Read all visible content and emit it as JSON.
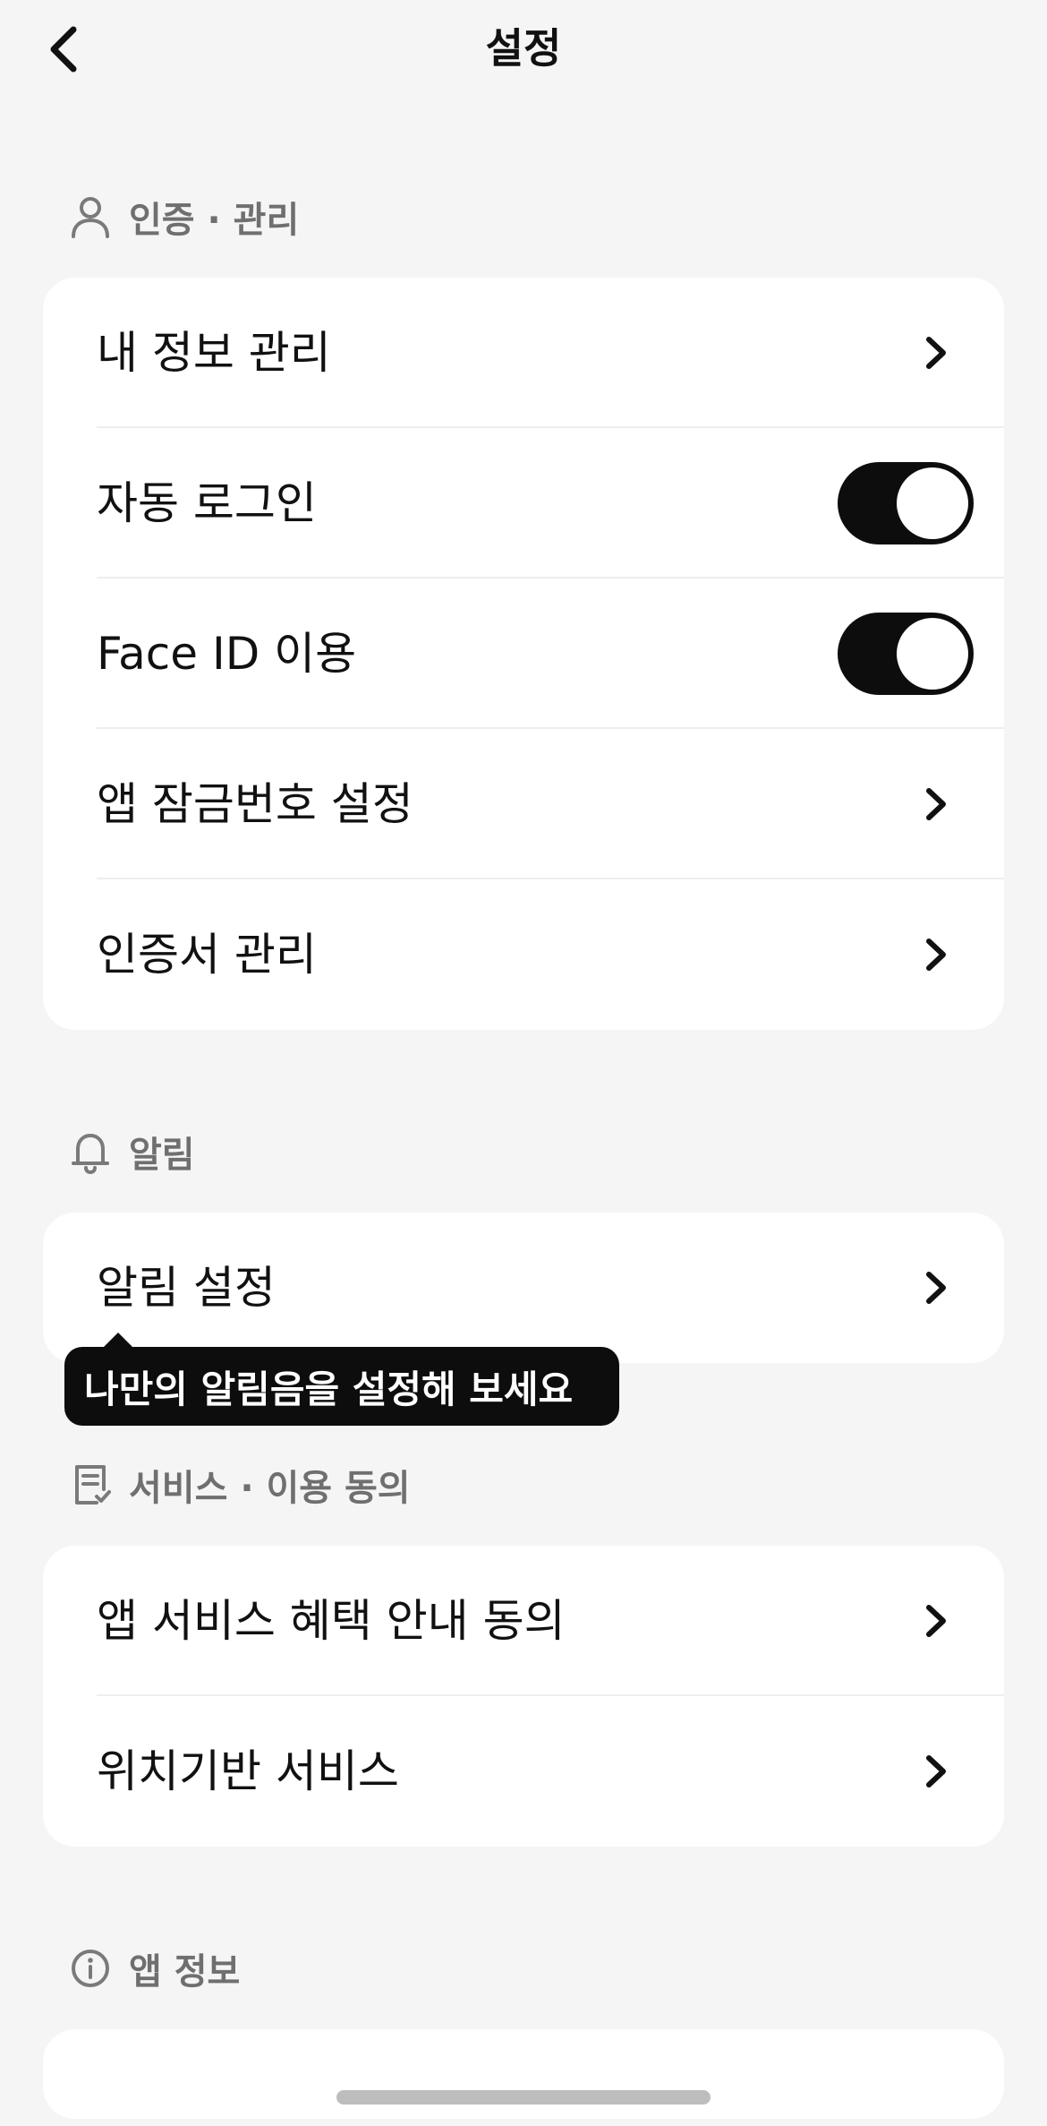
{
  "header": {
    "title": "설정"
  },
  "sections": {
    "auth": {
      "title": "인증 · 관리",
      "rows": [
        {
          "label": "내 정보 관리"
        },
        {
          "label": "자동 로그인",
          "toggle_on": true
        },
        {
          "label": "Face ID 이용",
          "toggle_on": true
        },
        {
          "label": "앱 잠금번호 설정"
        },
        {
          "label": "인증서 관리"
        }
      ]
    },
    "notifications": {
      "title": "알림",
      "rows": [
        {
          "label": "알림 설정"
        }
      ],
      "tooltip": "나만의 알림음을 설정해 보세요"
    },
    "service": {
      "title": "서비스 · 이용 동의",
      "rows": [
        {
          "label": "앱 서비스 혜택 안내 동의"
        },
        {
          "label": "위치기반 서비스"
        }
      ]
    },
    "app_info": {
      "title": "앱 정보"
    }
  },
  "icons": {
    "back": "chevron-left-icon",
    "auth": "user-icon",
    "notifications": "bell-icon",
    "service": "document-check-icon",
    "app_info": "info-icon",
    "row_chevron": "chevron-right-icon"
  },
  "colors": {
    "background": "#f5f5f5",
    "card": "#ffffff",
    "toggle_on": "#0d0d0d",
    "section_label": "#6f6f6f"
  }
}
